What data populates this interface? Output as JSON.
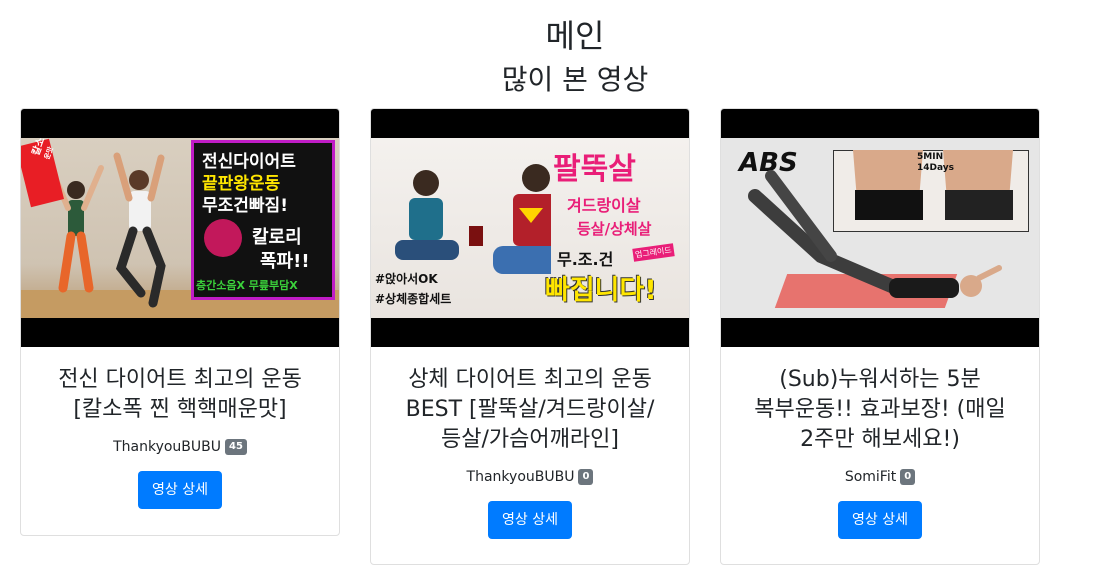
{
  "page": {
    "title": "메인",
    "section": "많이 본 영상"
  },
  "videos": [
    {
      "title": "전신 다이어트 최고의 운동 [칼소폭 찐 핵핵매운맛]",
      "channel": "ThankyouBUBU",
      "count": "45",
      "button": "영상 상세",
      "thumb_text": [
        "전신다이어트",
        "끝판왕운동",
        "무조건빠짐!",
        "칼로리",
        "폭파!!",
        "층간소음X 무릎부담X",
        "칼소폭",
        "찐 핵핵매운맛"
      ]
    },
    {
      "title": "상체 다이어트 최고의 운동 BEST [팔뚝살/겨드랑이살/등살/가슴어깨라인]",
      "channel": "ThankyouBUBU",
      "count": "0",
      "button": "영상 상세",
      "thumb_text": [
        "팔뚝살",
        "겨드랑이살",
        "등살/상체살",
        "무.조.건",
        "빠집니다!",
        "업그레이드",
        "#앉아서OK",
        "#상체종합세트"
      ]
    },
    {
      "title": "(Sub)누워서하는 5분 복부운동!! 효과보장! (매일 2주만 해보세요!)",
      "channel": "SomiFit",
      "count": "0",
      "button": "영상 상세",
      "thumb_text": [
        "ABS",
        "5MIN",
        "14Days"
      ]
    }
  ]
}
